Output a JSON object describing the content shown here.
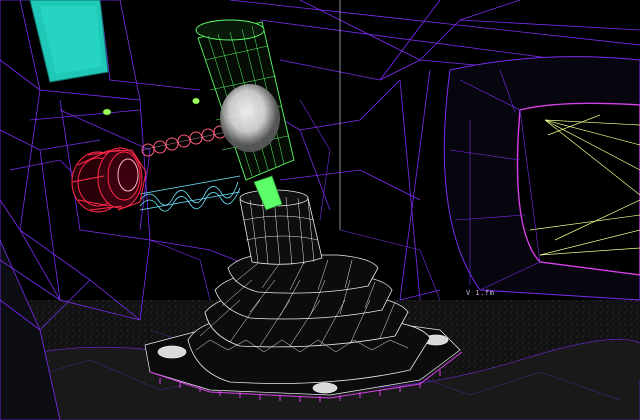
{
  "scene": {
    "description_free": true,
    "readout_text": "V 1.fm",
    "colors": {
      "background": "#000000",
      "wire_purple": "#7b2cf0",
      "wire_magenta": "#d640e8",
      "wire_white": "#eaeaf4",
      "wire_green": "#5cff6a",
      "wire_red": "#ff2a4a",
      "wire_cyan": "#6fe8ff",
      "wire_yellow": "#f1ff8a",
      "screen_teal": "#20c8b8"
    },
    "objects": [
      {
        "name": "control-panel-wall"
      },
      {
        "name": "teal-display-screen"
      },
      {
        "name": "green-indicator-lights"
      },
      {
        "name": "red-valve-wheel"
      },
      {
        "name": "cyan-coil-spring"
      },
      {
        "name": "pink-bead-chain"
      },
      {
        "name": "joystick-handle-green"
      },
      {
        "name": "joystick-stalk"
      },
      {
        "name": "joystick-boot-bellows"
      },
      {
        "name": "joystick-base-plate"
      },
      {
        "name": "porthole-window"
      },
      {
        "name": "cabin-ceiling-beams"
      },
      {
        "name": "floor-rubble"
      }
    ]
  }
}
